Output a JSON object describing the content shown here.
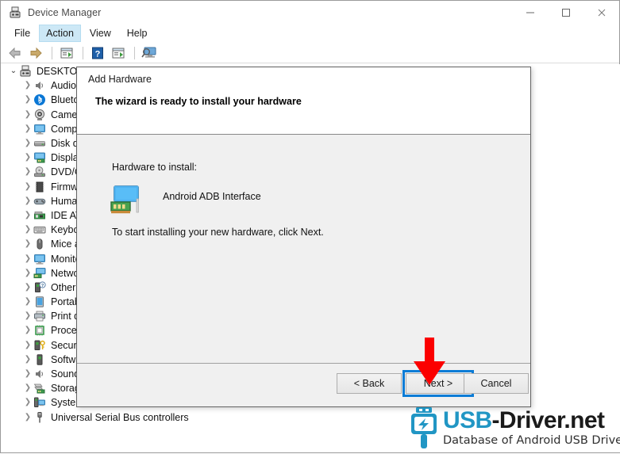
{
  "window": {
    "title": "Device Manager",
    "title_icon": "device-manager-icon",
    "controls": {
      "minimize": "minimize-icon",
      "maximize": "maximize-icon",
      "close": "close-icon"
    }
  },
  "menu": {
    "items": [
      {
        "label": "File",
        "active": false
      },
      {
        "label": "Action",
        "active": true
      },
      {
        "label": "View",
        "active": false
      },
      {
        "label": "Help",
        "active": false
      }
    ]
  },
  "toolbar": {
    "buttons": [
      {
        "name": "back-arrow-icon"
      },
      {
        "name": "forward-arrow-icon"
      },
      {
        "name": "separator"
      },
      {
        "name": "properties-icon"
      },
      {
        "name": "separator"
      },
      {
        "name": "help-icon"
      },
      {
        "name": "scan-hardware-icon"
      },
      {
        "name": "separator"
      },
      {
        "name": "show-hidden-devices-icon"
      }
    ]
  },
  "tree": {
    "root": {
      "label": "DESKTOP",
      "icon": "computer-icon",
      "expanded": true
    },
    "items": [
      {
        "label": "Audio inputs and outputs",
        "icon": "speaker-icon"
      },
      {
        "label": "Bluetooth",
        "icon": "bluetooth-icon"
      },
      {
        "label": "Cameras",
        "icon": "camera-icon"
      },
      {
        "label": "Computer",
        "icon": "monitor-icon"
      },
      {
        "label": "Disk drives",
        "icon": "disk-icon"
      },
      {
        "label": "Display adapters",
        "icon": "display-adapter-icon"
      },
      {
        "label": "DVD/CD-ROM drives",
        "icon": "dvd-icon"
      },
      {
        "label": "Firmware",
        "icon": "firmware-icon"
      },
      {
        "label": "Human Interface Devices",
        "icon": "gamepad-icon"
      },
      {
        "label": "IDE ATA/ATAPI controllers",
        "icon": "ide-controller-icon"
      },
      {
        "label": "Keyboards",
        "icon": "keyboard-icon"
      },
      {
        "label": "Mice and other pointing devices",
        "icon": "mouse-icon"
      },
      {
        "label": "Monitors",
        "icon": "monitor-icon"
      },
      {
        "label": "Network adapters",
        "icon": "network-adapter-icon"
      },
      {
        "label": "Other devices",
        "icon": "unknown-device-icon"
      },
      {
        "label": "Portable Devices",
        "icon": "portable-device-icon"
      },
      {
        "label": "Print queues",
        "icon": "printer-icon"
      },
      {
        "label": "Processors",
        "icon": "processor-icon"
      },
      {
        "label": "Security devices",
        "icon": "security-device-icon"
      },
      {
        "label": "Software devices",
        "icon": "software-device-icon"
      },
      {
        "label": "Sound, video and game controllers",
        "icon": "speaker-icon"
      },
      {
        "label": "Storage controllers",
        "icon": "storage-controller-icon"
      },
      {
        "label": "System devices",
        "icon": "system-device-icon"
      },
      {
        "label": "Universal Serial Bus controllers",
        "icon": "usb-icon"
      }
    ]
  },
  "dialog": {
    "caption": "Add Hardware",
    "heading": "The wizard is ready to install your hardware",
    "hardware_label": "Hardware to install:",
    "hardware_icon": "network-adapter-icon",
    "hardware_name": "Android ADB Interface",
    "instruction": "To start installing your new hardware, click Next.",
    "buttons": {
      "back": "< Back",
      "next": "Next >",
      "cancel": "Cancel"
    },
    "highlight_color": "#0a7cd6"
  },
  "annotation": {
    "arrow": "down-arrow-annotation",
    "arrow_color": "#fb0000"
  },
  "watermark": {
    "icon": "usb-plug-icon",
    "title_primary": "USB",
    "title_secondary": "-Driver.net",
    "subtitle": "Database of Android USB Driver",
    "accent_color": "#2196c4"
  }
}
